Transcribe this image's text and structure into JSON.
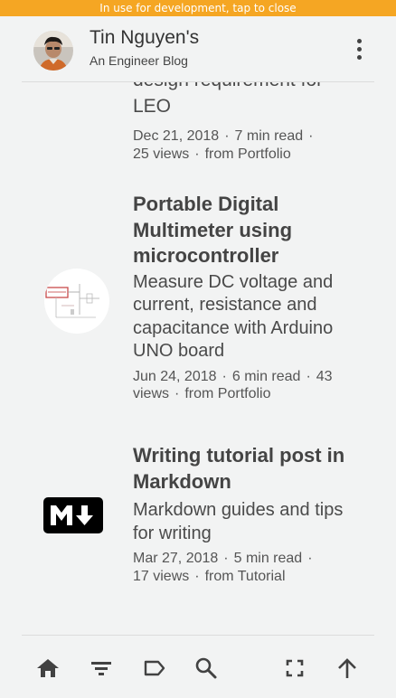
{
  "banner": {
    "text": "In use for development, tap to close"
  },
  "header": {
    "title": "Tin Nguyen's",
    "subtitle": "An Engineer Blog",
    "menu_icon": "more-vert-icon"
  },
  "posts": [
    {
      "title_partial": "design requirement for",
      "title_tail": "LEO",
      "date": "Dec 21, 2018",
      "read": "7 min read",
      "views": "25 views",
      "category": "from Portfolio"
    },
    {
      "title": "Portable Digital Multimeter using microcontroller",
      "excerpt": "Measure DC voltage and current, resistance and capacitance with Arduino UNO board",
      "date": "Jun 24, 2018",
      "read": "6 min read",
      "views_a": "43",
      "views_b": "views",
      "category": "from Portfolio",
      "thumb_icon": "circuit-schematic-thumbnail"
    },
    {
      "title": "Writing tutorial post in Markdown",
      "excerpt": "Markdown guides and tips for writing",
      "date": "Mar 27, 2018",
      "read": "5 min read",
      "views": "17 views",
      "category": "from Tutorial",
      "thumb_icon": "markdown-logo"
    }
  ],
  "bottom_nav": [
    {
      "name": "home-icon"
    },
    {
      "name": "filter-icon"
    },
    {
      "name": "tag-icon"
    },
    {
      "name": "search-icon"
    },
    {
      "name": "fullscreen-icon"
    },
    {
      "name": "arrow-up-icon"
    }
  ],
  "colors": {
    "banner": "#f5a623",
    "background": "#f2f3f3",
    "text": "#424242"
  }
}
